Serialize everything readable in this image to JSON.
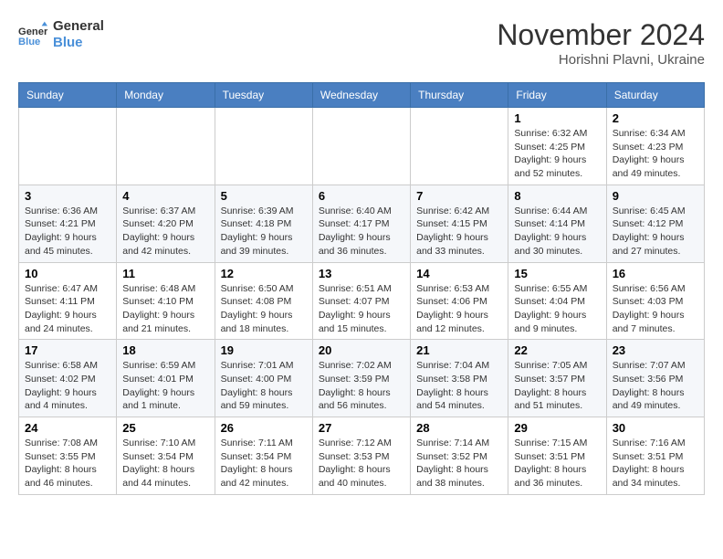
{
  "logo": {
    "text_general": "General",
    "text_blue": "Blue"
  },
  "title": "November 2024",
  "subtitle": "Horishni Plavni, Ukraine",
  "headers": [
    "Sunday",
    "Monday",
    "Tuesday",
    "Wednesday",
    "Thursday",
    "Friday",
    "Saturday"
  ],
  "weeks": [
    [
      {
        "day": "",
        "info": ""
      },
      {
        "day": "",
        "info": ""
      },
      {
        "day": "",
        "info": ""
      },
      {
        "day": "",
        "info": ""
      },
      {
        "day": "",
        "info": ""
      },
      {
        "day": "1",
        "info": "Sunrise: 6:32 AM\nSunset: 4:25 PM\nDaylight: 9 hours and 52 minutes."
      },
      {
        "day": "2",
        "info": "Sunrise: 6:34 AM\nSunset: 4:23 PM\nDaylight: 9 hours and 49 minutes."
      }
    ],
    [
      {
        "day": "3",
        "info": "Sunrise: 6:36 AM\nSunset: 4:21 PM\nDaylight: 9 hours and 45 minutes."
      },
      {
        "day": "4",
        "info": "Sunrise: 6:37 AM\nSunset: 4:20 PM\nDaylight: 9 hours and 42 minutes."
      },
      {
        "day": "5",
        "info": "Sunrise: 6:39 AM\nSunset: 4:18 PM\nDaylight: 9 hours and 39 minutes."
      },
      {
        "day": "6",
        "info": "Sunrise: 6:40 AM\nSunset: 4:17 PM\nDaylight: 9 hours and 36 minutes."
      },
      {
        "day": "7",
        "info": "Sunrise: 6:42 AM\nSunset: 4:15 PM\nDaylight: 9 hours and 33 minutes."
      },
      {
        "day": "8",
        "info": "Sunrise: 6:44 AM\nSunset: 4:14 PM\nDaylight: 9 hours and 30 minutes."
      },
      {
        "day": "9",
        "info": "Sunrise: 6:45 AM\nSunset: 4:12 PM\nDaylight: 9 hours and 27 minutes."
      }
    ],
    [
      {
        "day": "10",
        "info": "Sunrise: 6:47 AM\nSunset: 4:11 PM\nDaylight: 9 hours and 24 minutes."
      },
      {
        "day": "11",
        "info": "Sunrise: 6:48 AM\nSunset: 4:10 PM\nDaylight: 9 hours and 21 minutes."
      },
      {
        "day": "12",
        "info": "Sunrise: 6:50 AM\nSunset: 4:08 PM\nDaylight: 9 hours and 18 minutes."
      },
      {
        "day": "13",
        "info": "Sunrise: 6:51 AM\nSunset: 4:07 PM\nDaylight: 9 hours and 15 minutes."
      },
      {
        "day": "14",
        "info": "Sunrise: 6:53 AM\nSunset: 4:06 PM\nDaylight: 9 hours and 12 minutes."
      },
      {
        "day": "15",
        "info": "Sunrise: 6:55 AM\nSunset: 4:04 PM\nDaylight: 9 hours and 9 minutes."
      },
      {
        "day": "16",
        "info": "Sunrise: 6:56 AM\nSunset: 4:03 PM\nDaylight: 9 hours and 7 minutes."
      }
    ],
    [
      {
        "day": "17",
        "info": "Sunrise: 6:58 AM\nSunset: 4:02 PM\nDaylight: 9 hours and 4 minutes."
      },
      {
        "day": "18",
        "info": "Sunrise: 6:59 AM\nSunset: 4:01 PM\nDaylight: 9 hours and 1 minute."
      },
      {
        "day": "19",
        "info": "Sunrise: 7:01 AM\nSunset: 4:00 PM\nDaylight: 8 hours and 59 minutes."
      },
      {
        "day": "20",
        "info": "Sunrise: 7:02 AM\nSunset: 3:59 PM\nDaylight: 8 hours and 56 minutes."
      },
      {
        "day": "21",
        "info": "Sunrise: 7:04 AM\nSunset: 3:58 PM\nDaylight: 8 hours and 54 minutes."
      },
      {
        "day": "22",
        "info": "Sunrise: 7:05 AM\nSunset: 3:57 PM\nDaylight: 8 hours and 51 minutes."
      },
      {
        "day": "23",
        "info": "Sunrise: 7:07 AM\nSunset: 3:56 PM\nDaylight: 8 hours and 49 minutes."
      }
    ],
    [
      {
        "day": "24",
        "info": "Sunrise: 7:08 AM\nSunset: 3:55 PM\nDaylight: 8 hours and 46 minutes."
      },
      {
        "day": "25",
        "info": "Sunrise: 7:10 AM\nSunset: 3:54 PM\nDaylight: 8 hours and 44 minutes."
      },
      {
        "day": "26",
        "info": "Sunrise: 7:11 AM\nSunset: 3:54 PM\nDaylight: 8 hours and 42 minutes."
      },
      {
        "day": "27",
        "info": "Sunrise: 7:12 AM\nSunset: 3:53 PM\nDaylight: 8 hours and 40 minutes."
      },
      {
        "day": "28",
        "info": "Sunrise: 7:14 AM\nSunset: 3:52 PM\nDaylight: 8 hours and 38 minutes."
      },
      {
        "day": "29",
        "info": "Sunrise: 7:15 AM\nSunset: 3:51 PM\nDaylight: 8 hours and 36 minutes."
      },
      {
        "day": "30",
        "info": "Sunrise: 7:16 AM\nSunset: 3:51 PM\nDaylight: 8 hours and 34 minutes."
      }
    ]
  ]
}
